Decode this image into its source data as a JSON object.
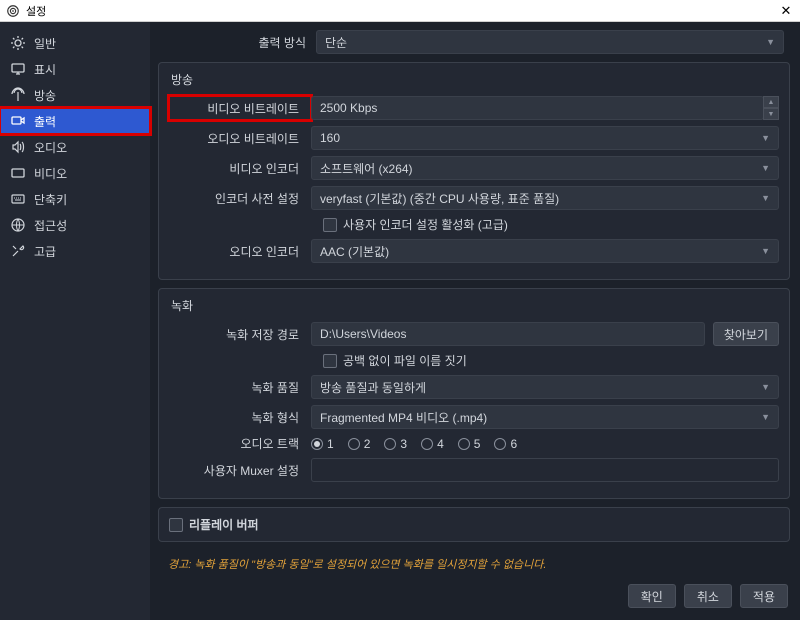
{
  "window": {
    "title": "설정"
  },
  "sidebar": {
    "items": [
      {
        "label": "일반"
      },
      {
        "label": "표시"
      },
      {
        "label": "방송"
      },
      {
        "label": "출력"
      },
      {
        "label": "오디오"
      },
      {
        "label": "비디오"
      },
      {
        "label": "단축키"
      },
      {
        "label": "접근성"
      },
      {
        "label": "고급"
      }
    ]
  },
  "output_mode": {
    "label": "출력 방식",
    "value": "단순"
  },
  "stream": {
    "title": "방송",
    "video_bitrate_label": "비디오 비트레이트",
    "video_bitrate_value": "2500 Kbps",
    "audio_bitrate_label": "오디오 비트레이트",
    "audio_bitrate_value": "160",
    "video_encoder_label": "비디오 인코더",
    "video_encoder_value": "소프트웨어 (x264)",
    "preset_label": "인코더 사전 설정",
    "preset_value": "veryfast (기본값) (중간 CPU 사용량, 표준 품질)",
    "custom_encoder_label": "사용자 인코더 설정 활성화 (고급)",
    "audio_encoder_label": "오디오 인코더",
    "audio_encoder_value": "AAC (기본값)"
  },
  "record": {
    "title": "녹화",
    "path_label": "녹화 저장 경로",
    "path_value": "D:\\Users\\Videos",
    "browse_label": "찾아보기",
    "nospace_label": "공백 없이 파일 이름 짓기",
    "quality_label": "녹화 품질",
    "quality_value": "방송 품질과 동일하게",
    "format_label": "녹화 형식",
    "format_value": "Fragmented MP4 비디오 (.mp4)",
    "tracks_label": "오디오 트랙",
    "tracks": [
      "1",
      "2",
      "3",
      "4",
      "5",
      "6"
    ],
    "muxer_label": "사용자 Muxer 설정"
  },
  "replay": {
    "label": "리플레이 버퍼"
  },
  "warning": "경고: 녹화 품질이 \"방송과 동일\"로 설정되어 있으면 녹화를 일시정지할 수 없습니다.",
  "buttons": {
    "ok": "확인",
    "cancel": "취소",
    "apply": "적용"
  }
}
